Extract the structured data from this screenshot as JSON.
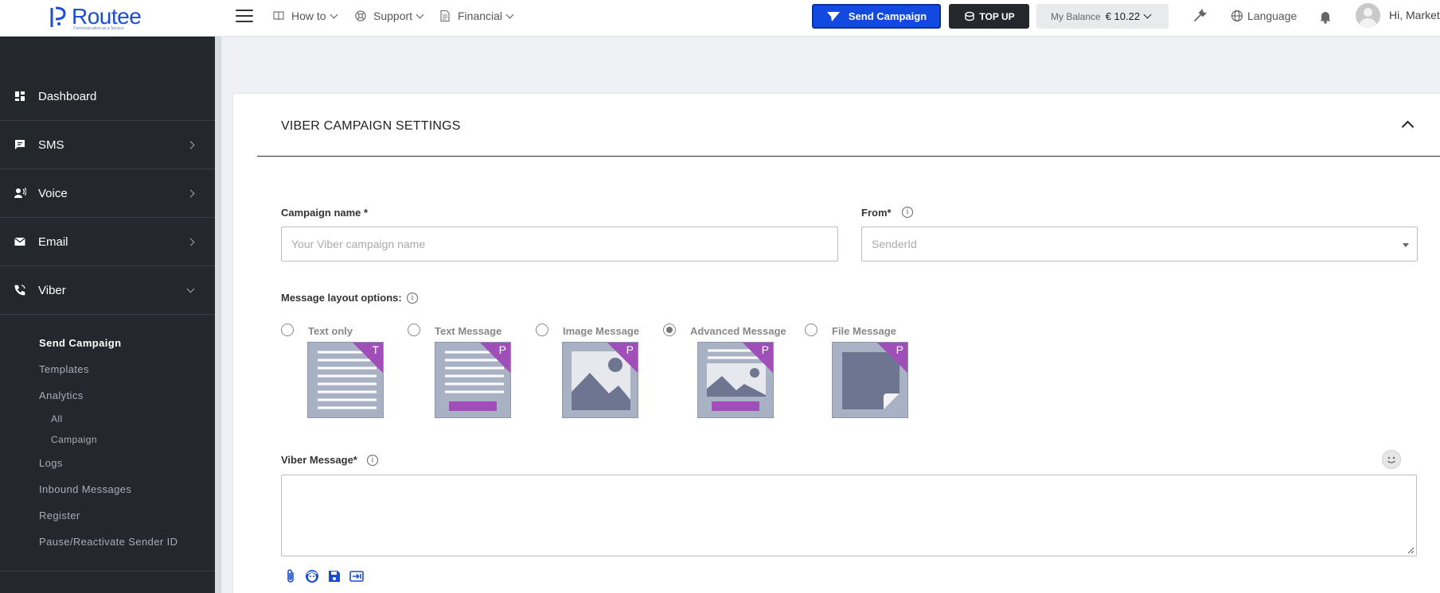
{
  "brand": {
    "name": "Routee",
    "tagline": "Communication as a Service"
  },
  "topnav": {
    "items": [
      {
        "label": "How to",
        "icon": "book-icon"
      },
      {
        "label": "Support",
        "icon": "lifebuoy-icon"
      },
      {
        "label": "Financial",
        "icon": "document-icon"
      }
    ],
    "send_campaign": "Send Campaign",
    "top_up": "TOP UP",
    "balance_label": "My Balance",
    "balance_value": "€ 10.22",
    "language": "Language",
    "greeting": "Hi, Marketi"
  },
  "sidebar": {
    "items": [
      {
        "label": "Dashboard",
        "icon": "dashboard-icon"
      },
      {
        "label": "SMS",
        "icon": "chat-icon"
      },
      {
        "label": "Voice",
        "icon": "voice-icon"
      },
      {
        "label": "Email",
        "icon": "mail-icon"
      },
      {
        "label": "Viber",
        "icon": "phone-icon"
      }
    ],
    "viber_sub": {
      "send_campaign": "Send Campaign",
      "templates": "Templates",
      "analytics": "Analytics",
      "all": "All",
      "campaign": "Campaign",
      "logs": "Logs",
      "inbound": "Inbound Messages",
      "register": "Register",
      "pause": "Pause/Reactivate Sender ID"
    }
  },
  "main": {
    "title": "VIBER CAMPAIGN SETTINGS",
    "campaign_name_label": "Campaign name *",
    "campaign_name_placeholder": "Your Viber campaign name",
    "from_label": "From*",
    "from_placeholder": "SenderId",
    "layout_label": "Message layout options:",
    "layouts": [
      {
        "label": "Text only",
        "badge": "T",
        "selected": false
      },
      {
        "label": "Text Message",
        "badge": "P",
        "selected": false
      },
      {
        "label": "Image Message",
        "badge": "P",
        "selected": false
      },
      {
        "label": "Advanced Message",
        "badge": "P",
        "selected": true
      },
      {
        "label": "File Message",
        "badge": "P",
        "selected": false
      }
    ],
    "message_label": "Viber Message*",
    "info_glyph": "i"
  },
  "colors": {
    "primary": "#1249e0",
    "sidebar": "#24272c",
    "badge": "#a14fb8",
    "thumb": "#a9b1c4"
  }
}
